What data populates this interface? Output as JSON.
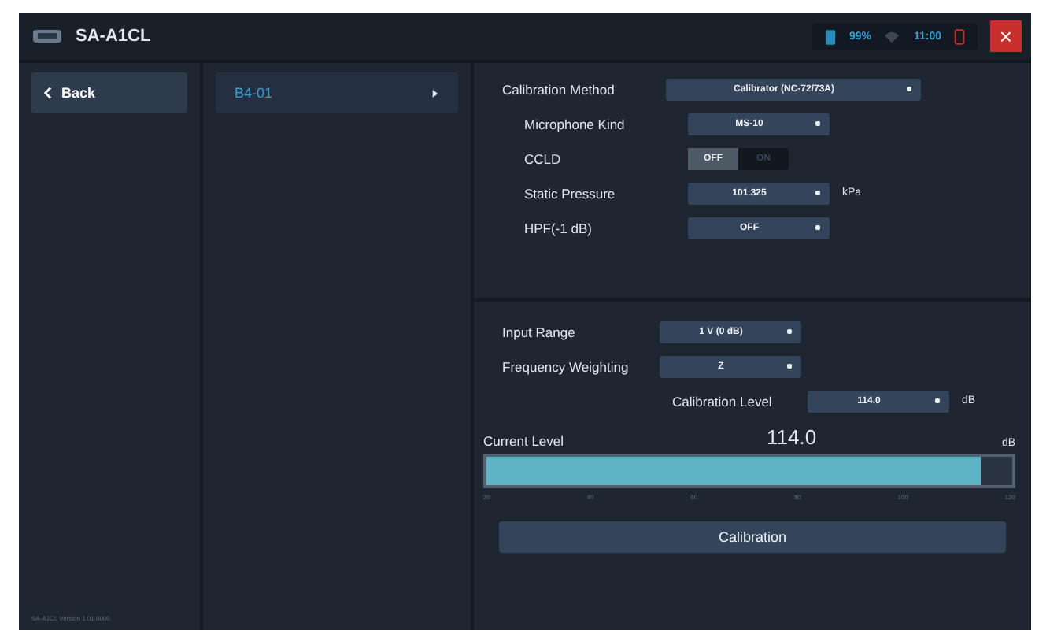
{
  "window": {
    "title": "SA-A1CL"
  },
  "status": {
    "battery": "99%",
    "time": "11:00",
    "close": "×"
  },
  "sidebar": {
    "back": "Back",
    "version": "SA-A1CL Version 1.01.0000"
  },
  "channel_list": [
    {
      "label": "B4-01",
      "selected": true
    }
  ],
  "settings": [
    {
      "kind": "select",
      "label": "Calibration Method",
      "value": "Calibrator (NC-72/73A)"
    },
    {
      "kind": "select",
      "label": "Microphone Kind",
      "value": "MS-10"
    },
    {
      "kind": "toggle",
      "label": "CCLD",
      "off": "OFF",
      "on_label": "ON",
      "on": false
    },
    {
      "kind": "select",
      "label": "Static Pressure",
      "value": "101.325",
      "unit": "kPa"
    },
    {
      "kind": "select",
      "label": "HPF(-1 dB)",
      "value": "OFF"
    }
  ],
  "input": [
    {
      "label": "Input Range",
      "value": "1 V (0 dB)"
    },
    {
      "label": "Frequency Weighting",
      "value": "Z"
    }
  ],
  "calibration_level": {
    "label": "Calibration Level",
    "value": "114.0",
    "unit": "dB"
  },
  "current_level": {
    "label": "Current Level",
    "reading": "114.0",
    "unit": "dB",
    "level": 0.94,
    "ticks": [
      "20",
      "40",
      "60",
      "80",
      "100",
      "120"
    ]
  },
  "calibrate_button": "Calibration"
}
